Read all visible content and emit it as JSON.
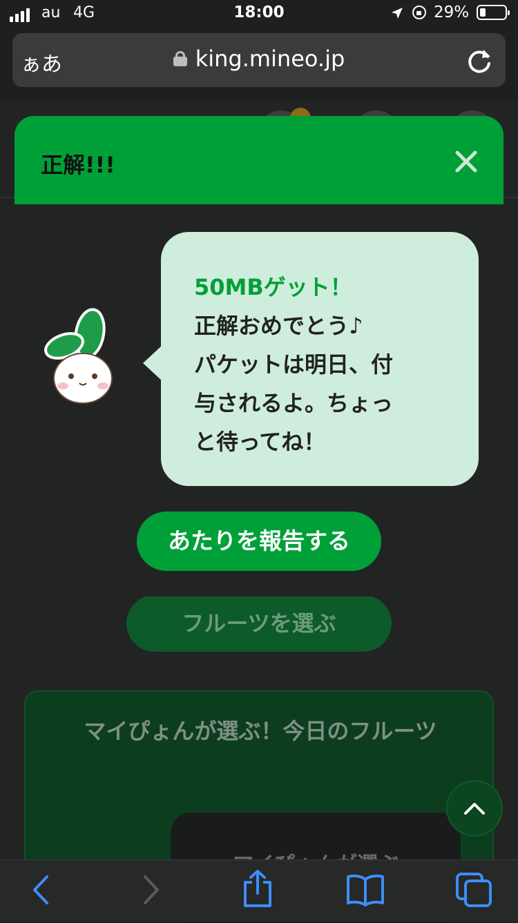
{
  "status_bar": {
    "carrier": "au",
    "network": "4G",
    "time": "18:00",
    "battery_percent": "29%",
    "battery_level": 0.29
  },
  "browser": {
    "aa_label": "ぁあ",
    "url": "king.mineo.jp"
  },
  "page": {
    "fruit_button_label": "フルーツを選ぶ",
    "today_title": "マイぴょんが選ぶ！今日のフルーツ",
    "inner_card_text": "マイぴょんが選ぶ"
  },
  "modal": {
    "title": "正解!!!",
    "message_highlight": "50MBゲット！",
    "message_lines": [
      "正解おめでとう♪",
      "パケットは明日、付",
      "与されるよ。ちょっ",
      "と待ってね！"
    ],
    "report_button_label": "あたりを報告する"
  },
  "colors": {
    "accent_green": "#00a038",
    "bubble_bg": "#cfeddc",
    "page_bg": "#222423"
  },
  "icons": {
    "close": "close-icon",
    "reload": "reload-icon",
    "back": "back-icon",
    "forward": "forward-icon",
    "share": "share-icon",
    "bookmarks": "bookmarks-icon",
    "tabs": "tabs-icon",
    "scroll_top": "chevron-up-icon"
  }
}
